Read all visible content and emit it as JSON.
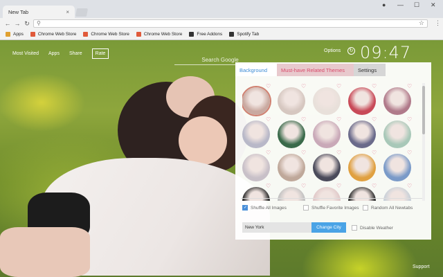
{
  "browser": {
    "tab_title": "New Tab",
    "tab_close": "×",
    "window_controls": {
      "account": "●",
      "minimize": "—",
      "maximize": "☐",
      "close": "✕"
    },
    "toolbar": {
      "back": "←",
      "forward": "→",
      "reload": "↻",
      "star": "☆",
      "menu": "⋮"
    },
    "bookmarks": [
      {
        "label": "Apps",
        "icon": "apps-grid-icon",
        "color": "#e0a030"
      },
      {
        "label": "Chrome Web Store",
        "icon": "chrome-store-icon",
        "color": "#e05a3a"
      },
      {
        "label": "Chrome Web Store",
        "icon": "chrome-store-icon",
        "color": "#e05a3a"
      },
      {
        "label": "Chrome Web Store",
        "icon": "chrome-store-icon",
        "color": "#e05a3a"
      },
      {
        "label": "Free Addons",
        "icon": "addon-icon",
        "color": "#333333"
      },
      {
        "label": "Spotify Tab",
        "icon": "addon-icon",
        "color": "#333333"
      }
    ]
  },
  "page": {
    "nav": {
      "most_visited": "Most Visited",
      "apps": "Apps",
      "share": "Share",
      "rate": "Rate"
    },
    "search_placeholder": "Search Google",
    "options": "Options",
    "clock": "09:47",
    "support": "Support"
  },
  "panel": {
    "tabs": {
      "background": "Background",
      "related": "Must-have Related Themes",
      "settings": "Settings"
    },
    "thumbnails": [
      "#c9a9a0",
      "#d6c7c0",
      "#e8e0da",
      "#c84a58",
      "#b07a8a",
      "#b8b8c8",
      "#3a6a4a",
      "#c9a9b8",
      "#6a6a8a",
      "#a8c8b8",
      "#c8c0c8",
      "#bfa89a",
      "#4a4a5a",
      "#e0a040",
      "#7a9ac8",
      "#2a2a2a",
      "#c0c0c0",
      "#e0c8c8",
      "#303030",
      "#c8d0d8"
    ],
    "options": {
      "shuffle_all": "Shuffle All Images",
      "shuffle_favorite": "Shuffle Favorite Images",
      "random_all": "Random All Newtabs",
      "shuffle_all_checked": true,
      "shuffle_favorite_checked": false,
      "random_all_checked": false
    },
    "weather": {
      "city": "New York",
      "change_city": "Change City",
      "disable_weather": "Disable Weather",
      "disable_weather_checked": false
    }
  },
  "colors": {
    "accent": "#4aa3e6",
    "related_tab": "#d94a6a",
    "heart": "#e26b8a"
  }
}
